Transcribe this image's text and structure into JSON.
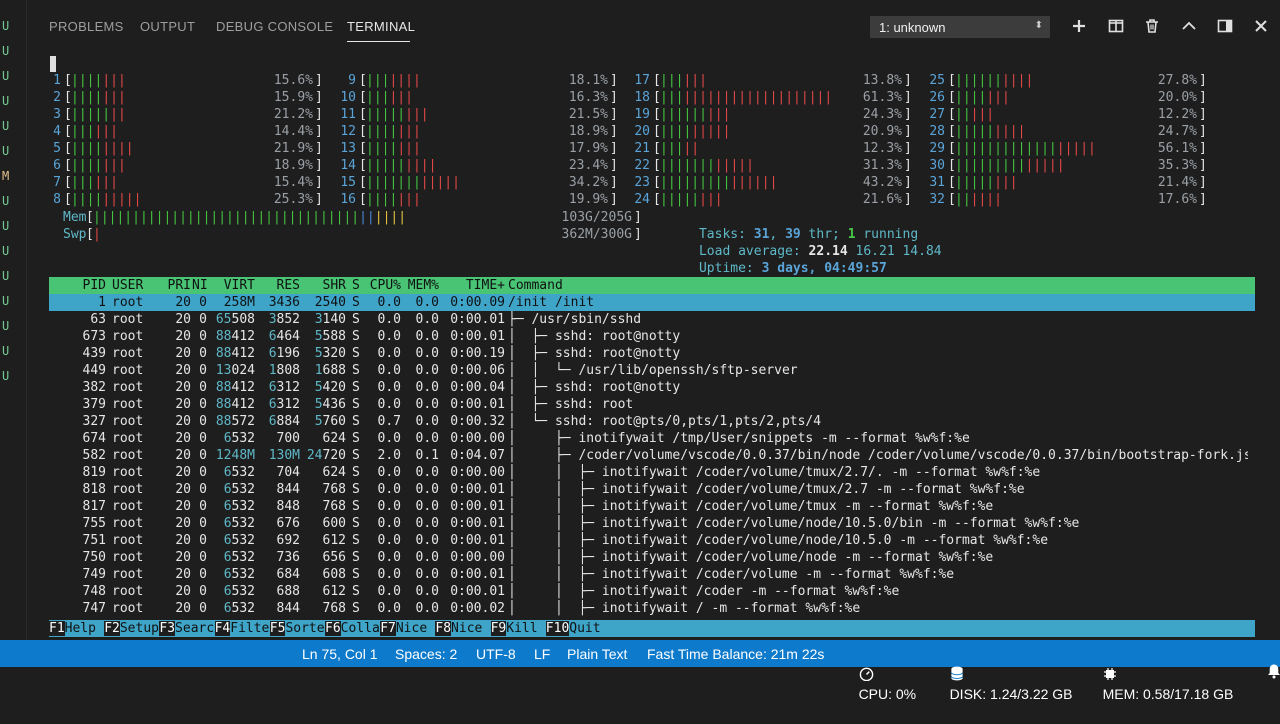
{
  "gutter": [
    "U",
    "U",
    "U",
    "U",
    "U",
    "U",
    "M",
    "U",
    "U",
    "U",
    "U",
    "U",
    "U",
    "U",
    "U"
  ],
  "tabs": [
    {
      "label": "PROBLEMS",
      "active": false
    },
    {
      "label": "OUTPUT",
      "active": false
    },
    {
      "label": "DEBUG CONSOLE",
      "active": false
    },
    {
      "label": "TERMINAL",
      "active": true
    }
  ],
  "terminal_select": {
    "value": "1: unknown"
  },
  "toolbar_icons": [
    "plus-icon",
    "split-icon",
    "trash-icon",
    "chevron-up-icon",
    "maximize-icon",
    "close-icon"
  ],
  "cpus": [
    {
      "n": "1",
      "g": 4,
      "r": 3,
      "p": "15.6%"
    },
    {
      "n": "2",
      "g": 4,
      "r": 3,
      "p": "15.9%"
    },
    {
      "n": "3",
      "g": 5,
      "r": 2,
      "p": "21.2%"
    },
    {
      "n": "4",
      "g": 3,
      "r": 3,
      "p": "14.4%"
    },
    {
      "n": "5",
      "g": 4,
      "r": 4,
      "p": "21.9%"
    },
    {
      "n": "6",
      "g": 4,
      "r": 3,
      "p": "18.9%"
    },
    {
      "n": "7",
      "g": 3,
      "r": 3,
      "p": "15.4%"
    },
    {
      "n": "8",
      "g": 4,
      "r": 5,
      "p": "25.3%"
    },
    {
      "n": "9",
      "g": 3,
      "r": 4,
      "p": "18.1%"
    },
    {
      "n": "10",
      "g": 3,
      "r": 3,
      "p": "16.3%"
    },
    {
      "n": "11",
      "g": 5,
      "r": 3,
      "p": "21.5%"
    },
    {
      "n": "12",
      "g": 4,
      "r": 3,
      "p": "18.9%"
    },
    {
      "n": "13",
      "g": 4,
      "r": 3,
      "p": "17.9%"
    },
    {
      "n": "14",
      "g": 5,
      "r": 4,
      "p": "23.4%"
    },
    {
      "n": "15",
      "g": 7,
      "r": 5,
      "p": "34.2%"
    },
    {
      "n": "16",
      "g": 4,
      "r": 3,
      "p": "19.9%"
    },
    {
      "n": "17",
      "g": 3,
      "r": 3,
      "p": "13.8%"
    },
    {
      "n": "18",
      "g": 3,
      "r": 19,
      "p": "61.3%"
    },
    {
      "n": "19",
      "g": 6,
      "r": 3,
      "p": "24.3%"
    },
    {
      "n": "20",
      "g": 4,
      "r": 5,
      "p": "20.9%"
    },
    {
      "n": "21",
      "g": 3,
      "r": 2,
      "p": "12.3%"
    },
    {
      "n": "22",
      "g": 7,
      "r": 5,
      "p": "31.3%"
    },
    {
      "n": "23",
      "g": 9,
      "r": 6,
      "p": "43.2%"
    },
    {
      "n": "24",
      "g": 5,
      "r": 3,
      "p": "21.6%"
    },
    {
      "n": "25",
      "g": 6,
      "r": 4,
      "p": "27.8%"
    },
    {
      "n": "26",
      "g": 4,
      "r": 3,
      "p": "20.0%"
    },
    {
      "n": "27",
      "g": 2,
      "r": 3,
      "p": "12.2%"
    },
    {
      "n": "28",
      "g": 5,
      "r": 4,
      "p": "24.7%"
    },
    {
      "n": "29",
      "g": 13,
      "r": 5,
      "p": "56.1%"
    },
    {
      "n": "30",
      "g": 9,
      "r": 5,
      "p": "35.3%"
    },
    {
      "n": "31",
      "g": 5,
      "r": 3,
      "p": "21.4%"
    },
    {
      "n": "32",
      "g": 2,
      "r": 4,
      "p": "17.6%"
    }
  ],
  "mem": {
    "label": "Mem",
    "value": "103G/205G",
    "green": 34,
    "blue": 2,
    "yellow": 4
  },
  "swp": {
    "label": "Swp",
    "value": "362M/300G",
    "red": 1
  },
  "tasks": {
    "label": "Tasks: ",
    "count": "31",
    "sep": ", ",
    "threads": "39",
    "thr_label": " thr; ",
    "running": "1",
    "running_label": " running"
  },
  "load": {
    "label": "Load average: ",
    "a": "22.14",
    "b": "16.21",
    "c": "14.84"
  },
  "uptime": {
    "label": "Uptime: ",
    "value": "3 days, 04:49:57"
  },
  "columns": {
    "pid": "PID",
    "user": "USER",
    "pri": "PRI",
    "ni": "NI",
    "virt": "VIRT",
    "res": "RES",
    "shr": "SHR",
    "s": "S",
    "cpu": "CPU%",
    "mem": "MEM%",
    "time": "TIME+",
    "cmd": "Command"
  },
  "processes": [
    {
      "pid": "1",
      "user": "root",
      "pri": "20",
      "ni": "0",
      "virt": "258M",
      "res": "3436",
      "shr": "2540",
      "s": "S",
      "cpu": "0.0",
      "mem": "0.0",
      "time": "0:00.09",
      "cmd": "/init /init",
      "selected": true
    },
    {
      "pid": "63",
      "user": "root",
      "pri": "20",
      "ni": "0",
      "virt": "65508",
      "res": "3852",
      "shr": "3140",
      "s": "S",
      "cpu": "0.0",
      "mem": "0.0",
      "time": "0:00.01",
      "tree": "├─ ",
      "cmd": "/usr/sbin/sshd"
    },
    {
      "pid": "673",
      "user": "root",
      "pri": "20",
      "ni": "0",
      "virt": "88412",
      "res": "6464",
      "shr": "5588",
      "s": "S",
      "cpu": "0.0",
      "mem": "0.0",
      "time": "0:00.01",
      "tree": "│  ├─ ",
      "cmd": "sshd: root@notty"
    },
    {
      "pid": "439",
      "user": "root",
      "pri": "20",
      "ni": "0",
      "virt": "88412",
      "res": "6196",
      "shr": "5320",
      "s": "S",
      "cpu": "0.0",
      "mem": "0.0",
      "time": "0:00.19",
      "tree": "│  ├─ ",
      "cmd": "sshd: root@notty"
    },
    {
      "pid": "449",
      "user": "root",
      "pri": "20",
      "ni": "0",
      "virt": "13024",
      "res": "1808",
      "shr": "1688",
      "s": "S",
      "cpu": "0.0",
      "mem": "0.0",
      "time": "0:00.06",
      "tree": "│  │  └─ ",
      "cmd": "/usr/lib/openssh/sftp-server"
    },
    {
      "pid": "382",
      "user": "root",
      "pri": "20",
      "ni": "0",
      "virt": "88412",
      "res": "6312",
      "shr": "5420",
      "s": "S",
      "cpu": "0.0",
      "mem": "0.0",
      "time": "0:00.04",
      "tree": "│  ├─ ",
      "cmd": "sshd: root@notty"
    },
    {
      "pid": "379",
      "user": "root",
      "pri": "20",
      "ni": "0",
      "virt": "88412",
      "res": "6312",
      "shr": "5436",
      "s": "S",
      "cpu": "0.0",
      "mem": "0.0",
      "time": "0:00.01",
      "tree": "│  ├─ ",
      "cmd": "sshd: root"
    },
    {
      "pid": "327",
      "user": "root",
      "pri": "20",
      "ni": "0",
      "virt": "88572",
      "res": "6884",
      "shr": "5760",
      "s": "S",
      "cpu": "0.7",
      "mem": "0.0",
      "time": "0:00.32",
      "tree": "│  └─ ",
      "cmd": "sshd: root@pts/0,pts/1,pts/2,pts/4"
    },
    {
      "pid": "674",
      "user": "root",
      "pri": "20",
      "ni": "0",
      "virt": "6532",
      "res": "700",
      "shr": "624",
      "s": "S",
      "cpu": "0.0",
      "mem": "0.0",
      "time": "0:00.00",
      "tree": "│     ├─ ",
      "cmd": "inotifywait /tmp/User/snippets -m --format %w%f:%e"
    },
    {
      "pid": "582",
      "user": "root",
      "pri": "20",
      "ni": "0",
      "virt": "1248M",
      "res": "130M",
      "shr": "24720",
      "s": "S",
      "cpu": "2.0",
      "mem": "0.1",
      "time": "0:04.07",
      "tree": "│     ├─ ",
      "cmd": "/coder/volume/vscode/0.0.37/bin/node /coder/volume/vscode/0.0.37/bin/bootstrap-fork.js",
      "hl": true
    },
    {
      "pid": "819",
      "user": "root",
      "pri": "20",
      "ni": "0",
      "virt": "6532",
      "res": "704",
      "shr": "624",
      "s": "S",
      "cpu": "0.0",
      "mem": "0.0",
      "time": "0:00.00",
      "tree": "│     │  ├─ ",
      "cmd": "inotifywait /coder/volume/tmux/2.7/. -m --format %w%f:%e"
    },
    {
      "pid": "818",
      "user": "root",
      "pri": "20",
      "ni": "0",
      "virt": "6532",
      "res": "844",
      "shr": "768",
      "s": "S",
      "cpu": "0.0",
      "mem": "0.0",
      "time": "0:00.01",
      "tree": "│     │  ├─ ",
      "cmd": "inotifywait /coder/volume/tmux/2.7 -m --format %w%f:%e"
    },
    {
      "pid": "817",
      "user": "root",
      "pri": "20",
      "ni": "0",
      "virt": "6532",
      "res": "848",
      "shr": "768",
      "s": "S",
      "cpu": "0.0",
      "mem": "0.0",
      "time": "0:00.01",
      "tree": "│     │  ├─ ",
      "cmd": "inotifywait /coder/volume/tmux -m --format %w%f:%e"
    },
    {
      "pid": "755",
      "user": "root",
      "pri": "20",
      "ni": "0",
      "virt": "6532",
      "res": "676",
      "shr": "600",
      "s": "S",
      "cpu": "0.0",
      "mem": "0.0",
      "time": "0:00.01",
      "tree": "│     │  ├─ ",
      "cmd": "inotifywait /coder/volume/node/10.5.0/bin -m --format %w%f:%e"
    },
    {
      "pid": "751",
      "user": "root",
      "pri": "20",
      "ni": "0",
      "virt": "6532",
      "res": "692",
      "shr": "612",
      "s": "S",
      "cpu": "0.0",
      "mem": "0.0",
      "time": "0:00.01",
      "tree": "│     │  ├─ ",
      "cmd": "inotifywait /coder/volume/node/10.5.0 -m --format %w%f:%e"
    },
    {
      "pid": "750",
      "user": "root",
      "pri": "20",
      "ni": "0",
      "virt": "6532",
      "res": "736",
      "shr": "656",
      "s": "S",
      "cpu": "0.0",
      "mem": "0.0",
      "time": "0:00.00",
      "tree": "│     │  ├─ ",
      "cmd": "inotifywait /coder/volume/node -m --format %w%f:%e"
    },
    {
      "pid": "749",
      "user": "root",
      "pri": "20",
      "ni": "0",
      "virt": "6532",
      "res": "684",
      "shr": "608",
      "s": "S",
      "cpu": "0.0",
      "mem": "0.0",
      "time": "0:00.01",
      "tree": "│     │  ├─ ",
      "cmd": "inotifywait /coder/volume -m --format %w%f:%e"
    },
    {
      "pid": "748",
      "user": "root",
      "pri": "20",
      "ni": "0",
      "virt": "6532",
      "res": "688",
      "shr": "612",
      "s": "S",
      "cpu": "0.0",
      "mem": "0.0",
      "time": "0:00.01",
      "tree": "│     │  ├─ ",
      "cmd": "inotifywait /coder -m --format %w%f:%e"
    },
    {
      "pid": "747",
      "user": "root",
      "pri": "20",
      "ni": "0",
      "virt": "6532",
      "res": "844",
      "shr": "768",
      "s": "S",
      "cpu": "0.0",
      "mem": "0.0",
      "time": "0:00.02",
      "tree": "│     │  ├─ ",
      "cmd": "inotifywait / -m --format %w%f:%e"
    }
  ],
  "fkeys": [
    {
      "k": "F1",
      "l": "Help  "
    },
    {
      "k": "F2",
      "l": "Setup "
    },
    {
      "k": "F3",
      "l": "Search"
    },
    {
      "k": "F4",
      "l": "Filter"
    },
    {
      "k": "F5",
      "l": "Sorted"
    },
    {
      "k": "F6",
      "l": "Collap"
    },
    {
      "k": "F7",
      "l": "Nice -"
    },
    {
      "k": "F8",
      "l": "Nice +"
    },
    {
      "k": "F9",
      "l": "Kill  "
    },
    {
      "k": "F10",
      "l": "Quit"
    }
  ],
  "status": {
    "position": "Ln 75, Col 1",
    "spaces": "Spaces: 2",
    "encoding": "UTF-8",
    "eol": "LF",
    "language": "Plain Text",
    "time_balance": "Fast Time Balance: 21m 22s",
    "cpu": "CPU: 0%",
    "disk": "DISK: 1.24/3.22 GB",
    "mem": "MEM: 0.58/17.18 GB"
  },
  "colors": {
    "accent": "#0e7acc",
    "header_green": "#48c474",
    "selected_blue": "#3fa5c8"
  }
}
